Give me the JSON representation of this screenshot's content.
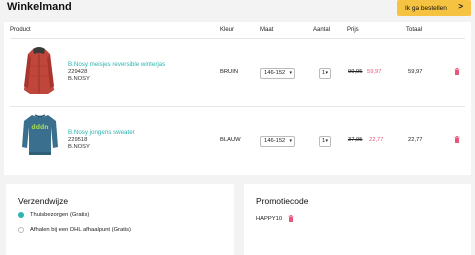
{
  "page": {
    "title": "Winkelmand"
  },
  "checkout": {
    "label": "Ik ga bestellen",
    "chevron": ">"
  },
  "table": {
    "headers": {
      "product": "Product",
      "color": "Kleur",
      "size": "Maat",
      "qty": "Aantal",
      "price": "Prijs",
      "total": "Totaal"
    },
    "rows": [
      {
        "name": "B.Nosy meisjes reversible winterjas",
        "sku": "229428",
        "brand": "B.NOSY",
        "color": "BRUIN",
        "size": "146-152",
        "qty": "1",
        "price_old": "99,95",
        "price_new": "59,97",
        "total": "59,97",
        "image": "red-winter-jacket"
      },
      {
        "name": "B.Nosy jongens sweater",
        "sku": "229518",
        "brand": "B.NOSY",
        "color": "BLAUW",
        "size": "146-152",
        "qty": "1",
        "price_old": "37,95",
        "price_new": "22,77",
        "total": "22,77",
        "image": "blue-sweater"
      }
    ]
  },
  "shipping": {
    "title": "Verzendwijze",
    "options": [
      {
        "label": "Thuisbezorgen (Gratis)",
        "selected": true
      },
      {
        "label": "Afhalen bij een DHL afhaalpunt (Gratis)",
        "selected": false
      }
    ]
  },
  "promo": {
    "title": "Promotiecode",
    "code": "HAPPY10"
  },
  "colors": {
    "accent": "#2bb5b2",
    "sale": "#e8557a",
    "button": "#f5c242",
    "trash": "#e8557a"
  }
}
